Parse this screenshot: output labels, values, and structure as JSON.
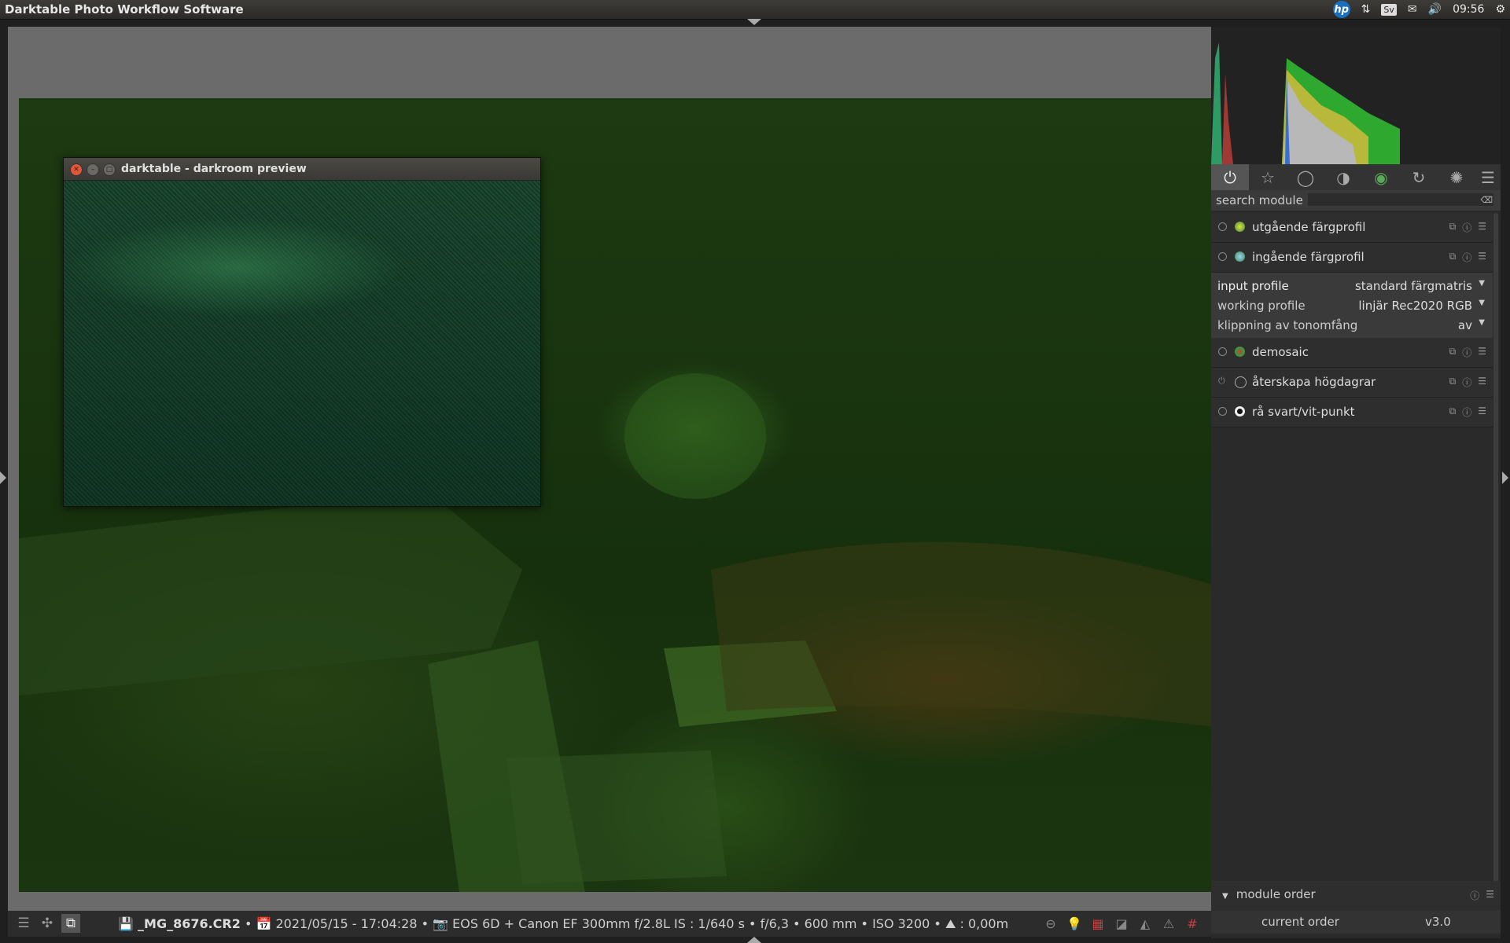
{
  "window": {
    "title": "Darktable Photo Workflow Software"
  },
  "tray": {
    "brand": "hp",
    "lang": "Sv",
    "time": "09:56"
  },
  "preview": {
    "title": "darktable - darkroom preview"
  },
  "search": {
    "label": "search module"
  },
  "modules": [
    {
      "label": "utgående färgprofil",
      "enabled": true
    },
    {
      "label": "ingående färgprofil",
      "enabled": true
    },
    {
      "label": "demosaic",
      "enabled": true
    },
    {
      "label": "återskapa högdagrar",
      "enabled": false
    },
    {
      "label": "rå svart/vit-punkt",
      "enabled": true
    }
  ],
  "params": [
    {
      "key": "input profile",
      "value": "standard färgmatris"
    },
    {
      "key": "working profile",
      "value": "linjär Rec2020 RGB"
    },
    {
      "key": "klippning av tonomfång",
      "value": "av"
    }
  ],
  "module_order": {
    "header": "module order",
    "key": "current order",
    "value": "v3.0"
  },
  "image_info": {
    "filename": "_MG_8676.CR2",
    "datetime": "2021/05/15 - 17:04:28",
    "camera": "EOS 6D + Canon EF 300mm f/2.8L IS",
    "exposure": ": 1/640 s",
    "aperture": "f/6,3",
    "focal": "600 mm",
    "iso": "ISO 3200",
    "distance": ": 0,00m"
  },
  "colors": {
    "accent_green": "#2e8b2e",
    "panel": "#2a2a2a"
  }
}
